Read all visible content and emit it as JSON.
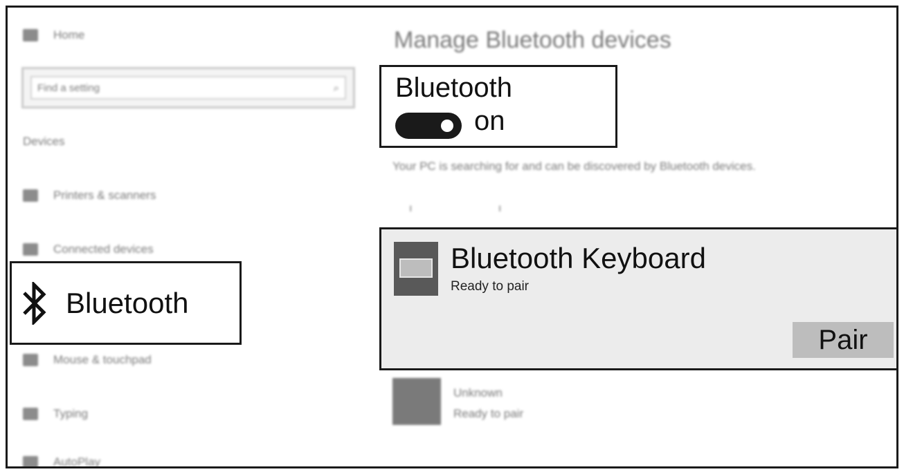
{
  "sidebar": {
    "home_label": "Home",
    "search_placeholder": "Find a setting",
    "section_label": "Devices",
    "items": [
      {
        "label": "Printers & scanners"
      },
      {
        "label": "Connected devices"
      },
      {
        "label": "Bluetooth"
      },
      {
        "label": "Mouse & touchpad"
      },
      {
        "label": "Typing"
      },
      {
        "label": "AutoPlay"
      }
    ]
  },
  "main": {
    "title": "Manage Bluetooth devices",
    "bluetooth_label": "Bluetooth",
    "toggle_state": "on",
    "description": "Your PC is searching for and can be discovered by Bluetooth devices.",
    "devices": [
      {
        "name": "Bluetooth Keyboard",
        "status": "Ready to pair",
        "action": "Pair"
      },
      {
        "name": "Unknown",
        "status": "Ready to pair"
      }
    ]
  }
}
